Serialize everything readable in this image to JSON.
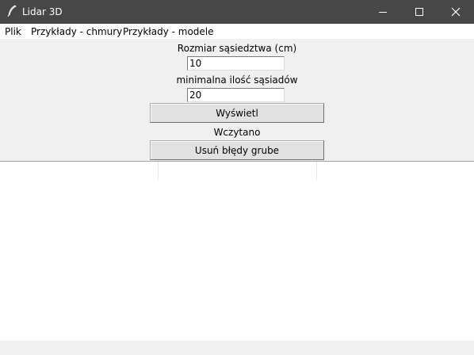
{
  "window": {
    "title": "Lidar 3D",
    "app_icon": "feather-icon",
    "controls": {
      "minimize": "minimize-icon",
      "maximize": "maximize-icon",
      "close": "close-icon"
    }
  },
  "menu": {
    "items": [
      "Plik",
      "Przykłady - chmury",
      "Przykłady - modele"
    ]
  },
  "form": {
    "neighborhood_label": "Rozmiar sąsiedztwa (cm)",
    "neighborhood_value": "10",
    "min_neighbors_label": "minimalna ilość sąsiadów",
    "min_neighbors_value": "20",
    "show_button": "Wyświetl",
    "status": "Wczytano",
    "remove_errors_button": "Usuń błędy grube"
  },
  "colors": {
    "titlebar": "#474747",
    "background": "#f0f0f0",
    "canvas": "#ffffff",
    "button": "#e1e1e1"
  }
}
